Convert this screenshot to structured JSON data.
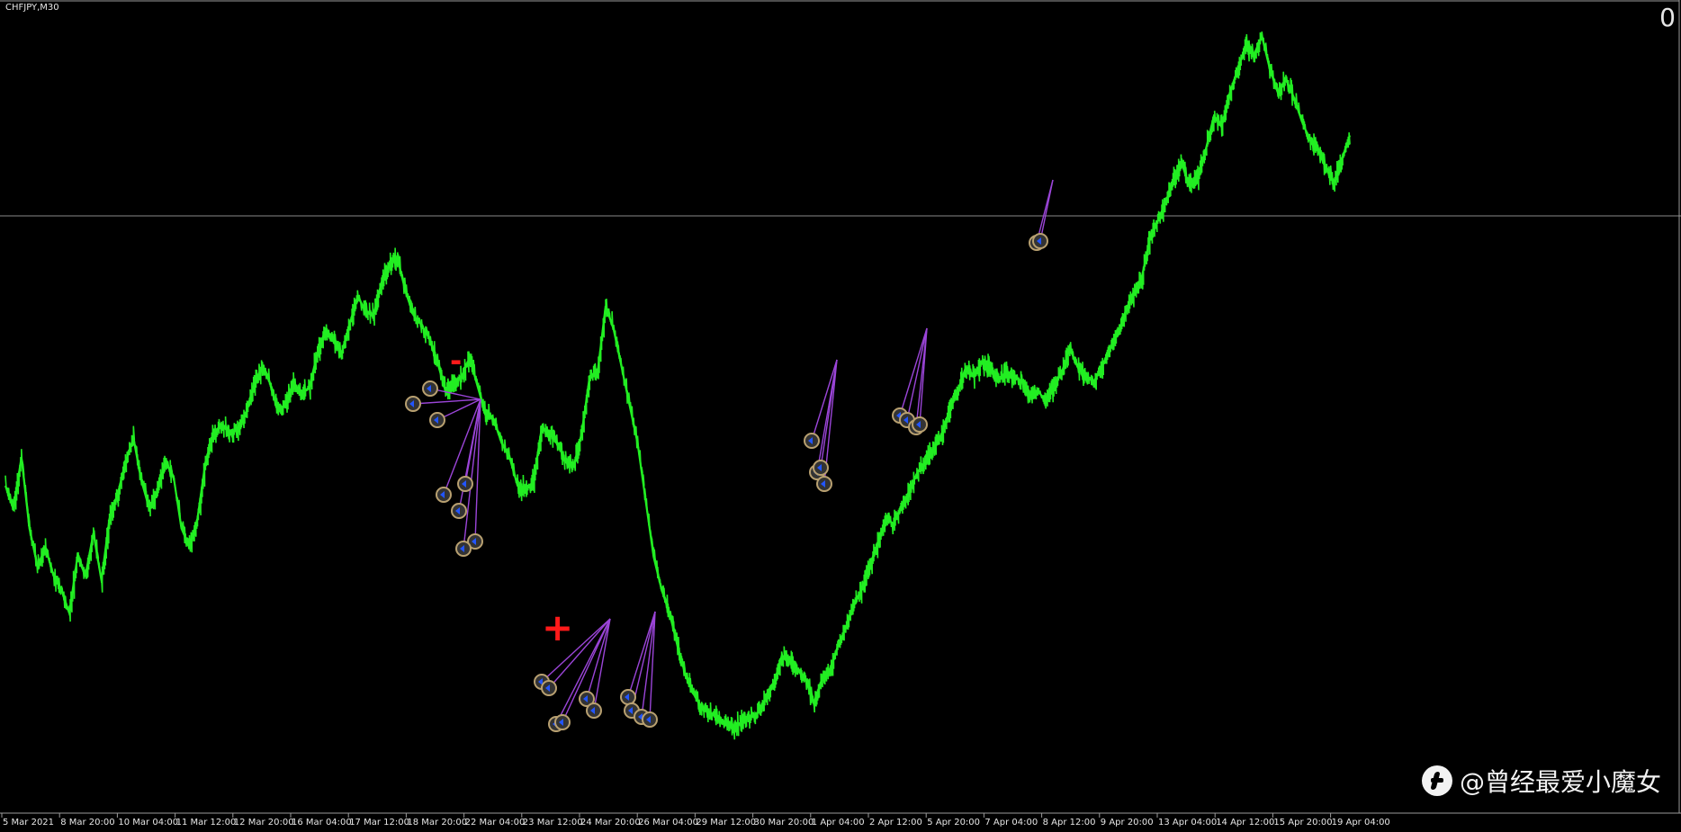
{
  "header": {
    "symbol_label": "CHFJPY,M30",
    "counter": "0"
  },
  "watermark": {
    "text": "@曾经最爱小魔女",
    "icon": "toutiao-logo-icon"
  },
  "annotations": [
    {
      "text": "-",
      "color": "#ff1a1a"
    },
    {
      "text": "+",
      "color": "#ff1a1a"
    }
  ],
  "colors": {
    "background": "#000000",
    "price_line": "#22ee22",
    "hline": "#8a8a8a",
    "trade_lines": "#9b45d8",
    "axis": "#9a9a9a",
    "text": "#e6e6e6"
  },
  "chart_data": {
    "type": "line",
    "title": "CHFJPY,M30",
    "xlabel": "",
    "ylabel": "",
    "grid": false,
    "x_ticks": [
      "5 Mar 2021",
      "8 Mar 20:00",
      "10 Mar 04:00",
      "11 Mar 12:00",
      "12 Mar 20:00",
      "16 Mar 04:00",
      "17 Mar 12:00",
      "18 Mar 20:00",
      "22 Mar 04:00",
      "23 Mar 12:00",
      "24 Mar 20:00",
      "26 Mar 04:00",
      "29 Mar 12:00",
      "30 Mar 20:00",
      "1 Apr 04:00",
      "2 Apr 12:00",
      "5 Apr 20:00",
      "7 Apr 04:00",
      "8 Apr 12:00",
      "9 Apr 20:00",
      "13 Apr 04:00",
      "14 Apr 12:00",
      "15 Apr 20:00",
      "19 Apr 04:00"
    ],
    "series": [
      {
        "values": [
          57,
          52,
          63,
          48,
          40,
          44,
          38,
          35,
          30,
          42,
          38,
          47,
          37,
          50,
          55,
          62,
          67,
          58,
          52,
          56,
          62,
          59,
          48,
          44,
          50,
          62,
          68,
          70,
          68,
          69,
          72,
          78,
          82,
          79,
          73,
          74,
          79,
          76,
          78,
          85,
          90,
          88,
          85,
          91,
          97,
          94,
          93,
          100,
          104,
          105,
          98,
          93,
          91,
          88,
          83,
          77,
          79,
          80,
          84,
          78,
          72,
          71,
          66,
          63,
          57,
          56,
          58,
          69,
          68,
          66,
          62,
          61,
          68,
          80,
          81,
          95,
          90,
          82,
          74,
          66,
          54,
          42,
          35,
          30,
          23,
          17,
          13,
          10,
          9,
          8,
          7,
          6,
          7,
          8,
          9,
          12,
          15,
          21,
          20,
          18,
          16,
          11,
          16,
          18,
          23,
          27,
          32,
          35,
          40,
          45,
          50,
          49,
          53,
          56,
          60,
          62,
          65,
          68,
          73,
          77,
          82,
          80,
          83,
          82,
          79,
          81,
          80,
          79,
          76,
          77,
          75,
          78,
          81,
          86,
          82,
          80,
          79,
          82,
          86,
          89,
          94,
          98,
          101,
          109,
          113,
          117,
          122,
          125,
          120,
          122,
          128,
          135,
          133,
          140,
          145,
          150,
          148,
          152,
          145,
          140,
          143,
          139,
          134,
          130,
          128,
          124,
          121,
          126,
          131
        ],
        "hline": 114
      }
    ],
    "xlim": [
      0,
      1
    ],
    "ylim": [
      0,
      152
    ]
  }
}
